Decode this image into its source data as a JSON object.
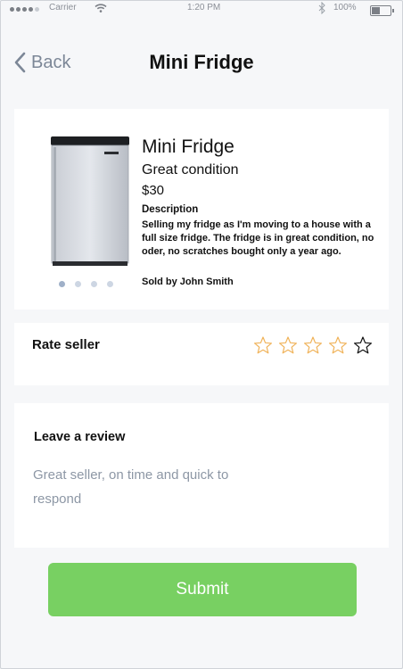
{
  "status_bar": {
    "carrier": "Carrier",
    "time": "1:20 PM",
    "battery": "100%",
    "battery_level": 0.45
  },
  "header": {
    "back_label": "Back",
    "title": "Mini Fridge"
  },
  "product": {
    "name": "Mini Fridge",
    "condition": "Great condition",
    "price": "$30",
    "description_label": "Description",
    "description": "Selling my fridge as I'm moving to a house with a full size fridge. The fridge is in great condition, no oder, no scratches bought only a year ago.",
    "seller": "Sold by John Smith",
    "image_count": 4,
    "active_image": 1
  },
  "rating": {
    "label": "Rate seller",
    "stars": 5,
    "selected": 0,
    "star_color": "#f0b35a",
    "last_star_color": "#111111"
  },
  "review": {
    "label": "Leave a review",
    "text": "Great seller, on time and quick to respond"
  },
  "submit": {
    "label": "Submit",
    "color": "#78d062"
  }
}
